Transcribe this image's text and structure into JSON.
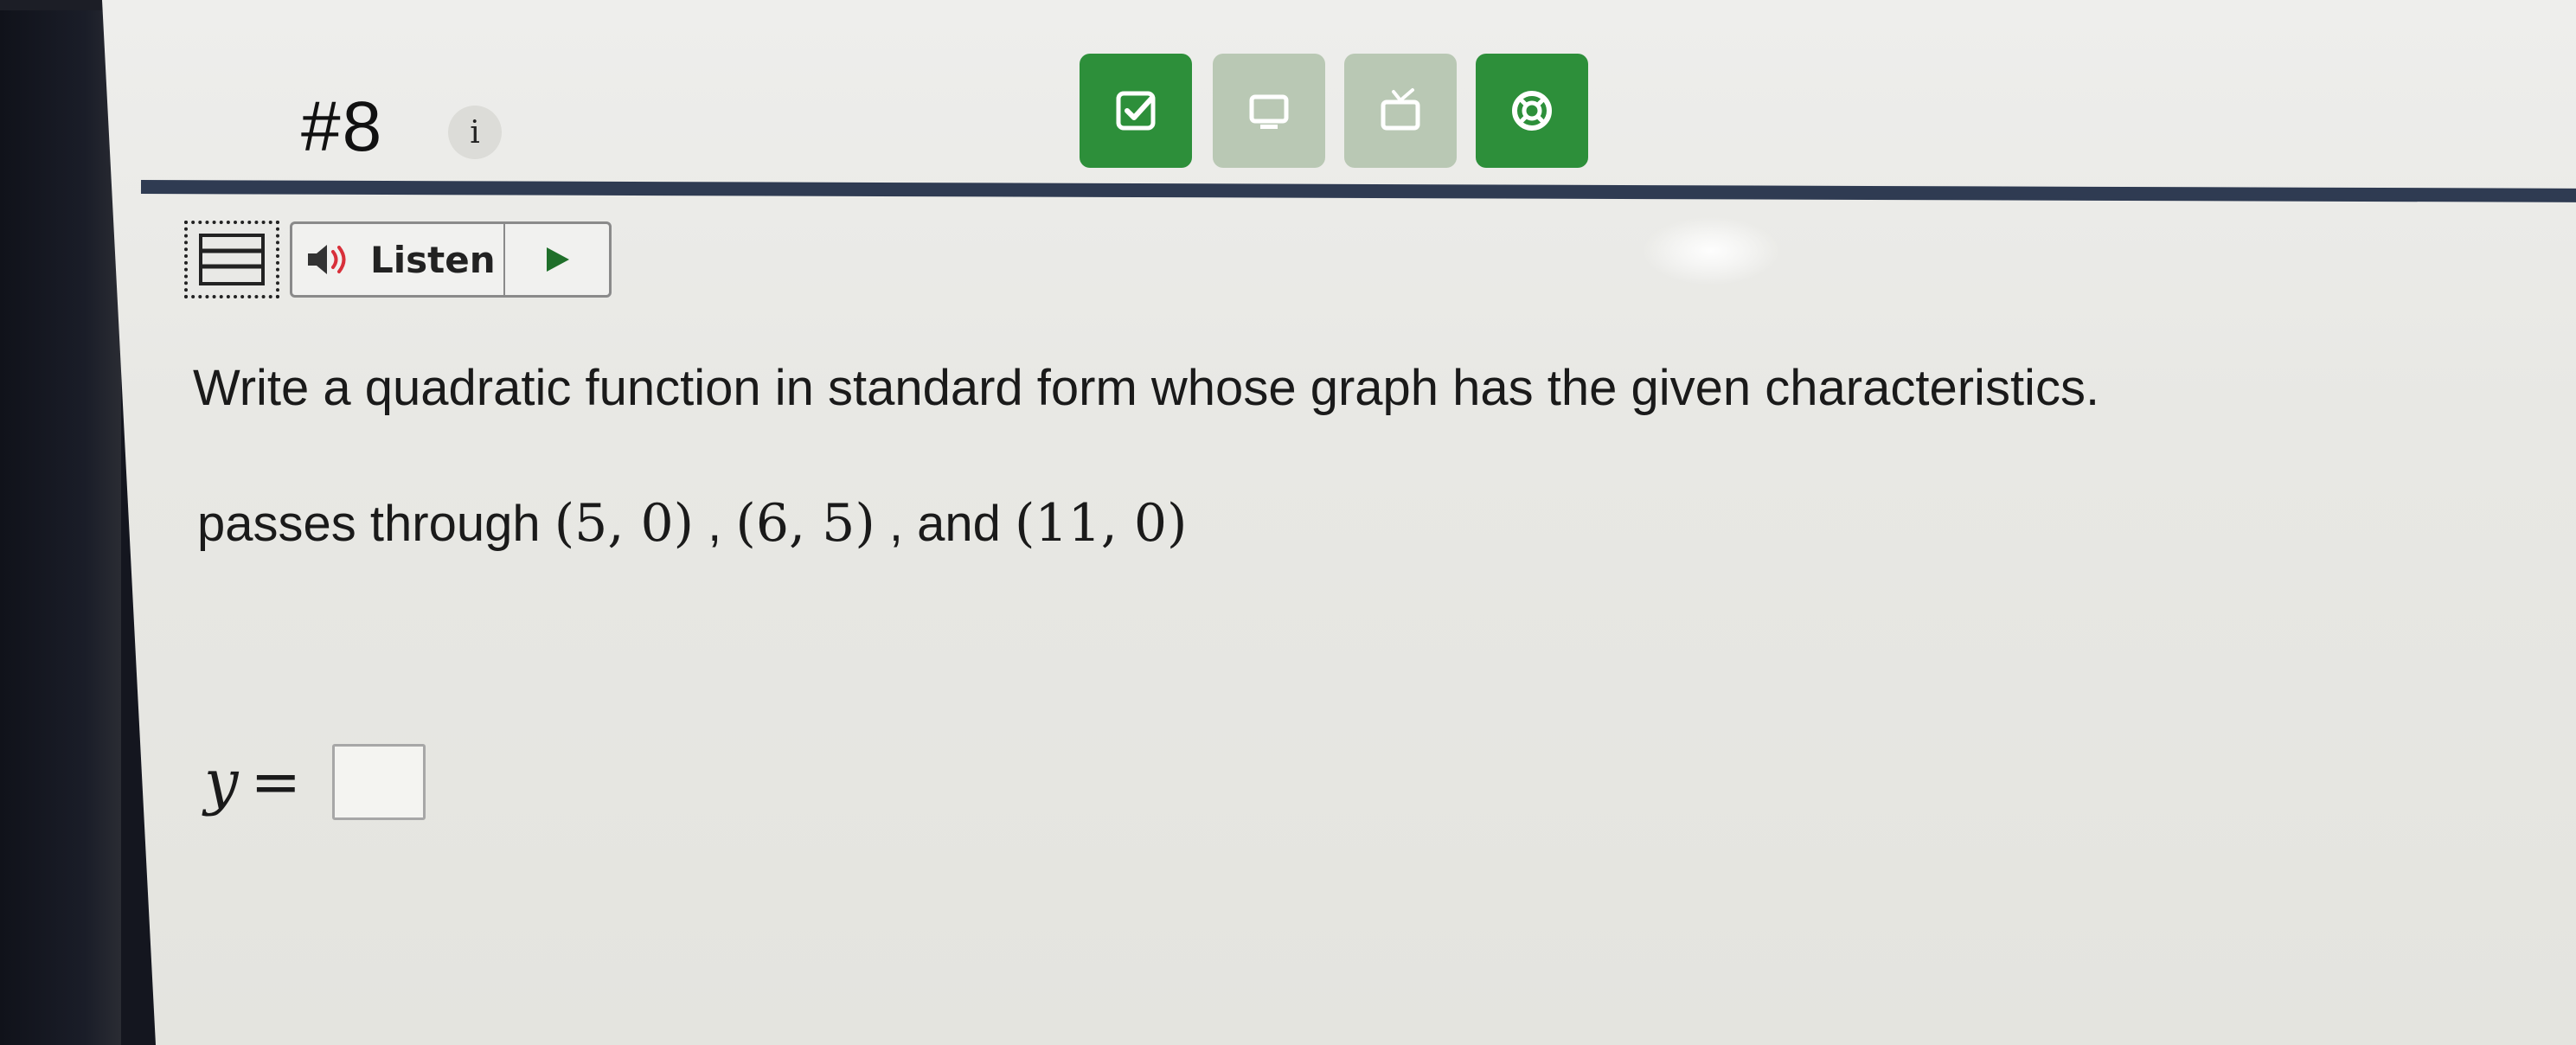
{
  "header": {
    "problem_number": "#8",
    "info_label": "i"
  },
  "toolbar": {
    "buttons": [
      {
        "icon": "check-square-icon",
        "state": "active"
      },
      {
        "icon": "screen-icon",
        "state": "disabled"
      },
      {
        "icon": "tv-icon",
        "state": "disabled"
      },
      {
        "icon": "help-lifebuoy-icon",
        "state": "active"
      }
    ],
    "active_color": "#2d8f3a",
    "disabled_color": "#b9c8b4"
  },
  "reader": {
    "listen_label": "Listen"
  },
  "question": {
    "prompt": "Write a quadratic function in standard form whose graph has the given characteristics.",
    "points_prefix": "passes through",
    "point1": "(5, 0)",
    "sep1": ",",
    "point2": "(6, 5)",
    "sep2": ", and",
    "point3": "(11, 0)"
  },
  "answer": {
    "variable": "y",
    "equals": "=",
    "value": ""
  },
  "colors": {
    "rule": "#2f3b52",
    "background": "#e8e8e4"
  }
}
